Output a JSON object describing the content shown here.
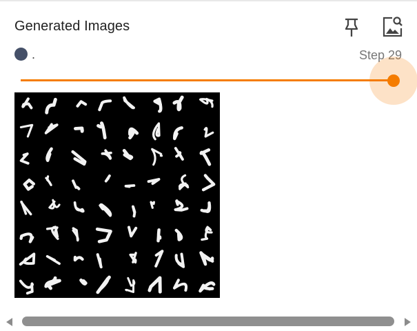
{
  "card": {
    "title": "Generated Images",
    "pin_icon": "pin-icon",
    "image_icon": "image-search-icon"
  },
  "run": {
    "label": ".",
    "color": "#455068"
  },
  "step": {
    "label": "Step 29",
    "value": 29
  },
  "slider": {
    "accent": "#f57c00",
    "position_fraction": 1.0
  },
  "image": {
    "description_icon": "generated-digit-grid",
    "grid_rows": 8,
    "grid_cols": 8
  },
  "scrollbar": {
    "left_icon": "scroll-left-icon",
    "right_icon": "scroll-right-icon"
  }
}
